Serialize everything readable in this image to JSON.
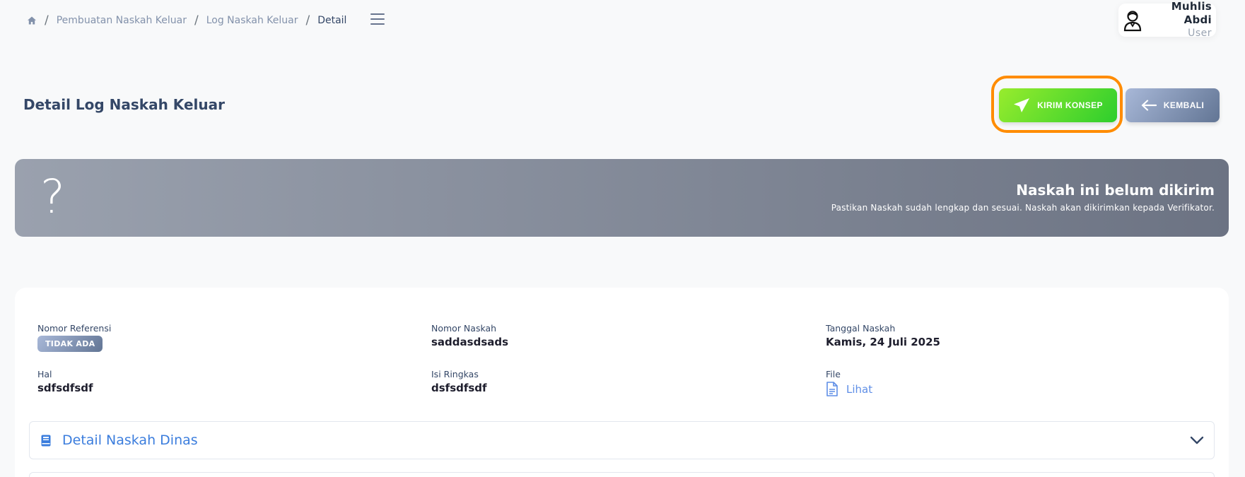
{
  "breadcrumb": {
    "items": [
      "Pembuatan Naskah Keluar",
      "Log Naskah Keluar",
      "Detail"
    ],
    "separator": "/"
  },
  "user": {
    "name": "Muhlis Abdi",
    "role": "User"
  },
  "page": {
    "title": "Detail Log Naskah Keluar"
  },
  "actions": {
    "send_label": "KIRIM KONSEP",
    "back_label": "KEMBALI"
  },
  "banner": {
    "icon": "?",
    "title": "Naskah ini belum dikirim",
    "subtitle": "Pastikan Naskah sudah lengkap dan sesuai. Naskah akan dikirimkan kepada Verifikator."
  },
  "details": {
    "nomor_referensi": {
      "label": "Nomor Referensi",
      "value": "TIDAK ADA"
    },
    "nomor_naskah": {
      "label": "Nomor Naskah",
      "value": "saddasdsads"
    },
    "tanggal_naskah": {
      "label": "Tanggal Naskah",
      "value": "Kamis, 24 Juli 2025"
    },
    "hal": {
      "label": "Hal",
      "value": "sdfsdfsdf"
    },
    "isi_ringkas": {
      "label": "Isi Ringkas",
      "value": "dsfsdfsdf"
    },
    "file": {
      "label": "File",
      "link_label": "Lihat"
    }
  },
  "accordion": {
    "title": "Detail Naskah Dinas"
  },
  "colors": {
    "send_button": "#2dce2d",
    "back_button": "#627594",
    "highlight": "#ff8c00",
    "link": "#5e8ee6"
  },
  "icons": {
    "home": "home-icon",
    "menu": "menu-icon",
    "avatar": "user-avatar-icon",
    "send": "paper-plane-icon",
    "back": "arrow-left-icon",
    "file": "document-icon",
    "book": "book-icon",
    "chevron": "chevron-down-icon"
  }
}
